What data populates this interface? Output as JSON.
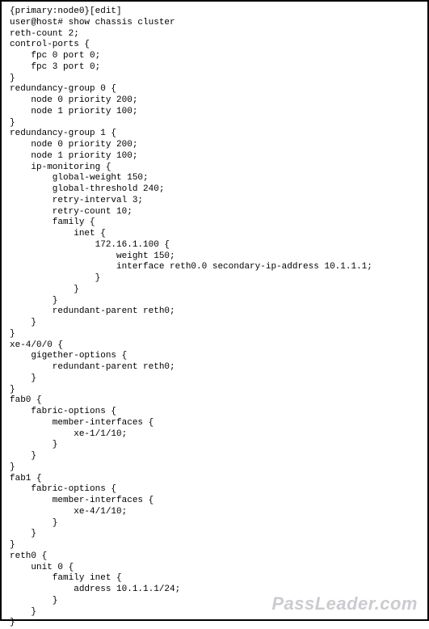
{
  "config_text": "{primary:node0}[edit]\nuser@host# show chassis cluster\nreth-count 2;\ncontrol-ports {\n    fpc 0 port 0;\n    fpc 3 port 0;\n}\nredundancy-group 0 {\n    node 0 priority 200;\n    node 1 priority 100;\n}\nredundancy-group 1 {\n    node 0 priority 200;\n    node 1 priority 100;\n    ip-monitoring {\n        global-weight 150;\n        global-threshold 240;\n        retry-interval 3;\n        retry-count 10;\n        family {\n            inet {\n                172.16.1.100 {\n                    weight 150;\n                    interface reth0.0 secondary-ip-address 10.1.1.1;\n                }\n            }\n        }\n        redundant-parent reth0;\n    }\n}\nxe-4/0/0 {\n    gigether-options {\n        redundant-parent reth0;\n    }\n}\nfab0 {\n    fabric-options {\n        member-interfaces {\n            xe-1/1/10;\n        }\n    }\n}\nfab1 {\n    fabric-options {\n        member-interfaces {\n            xe-4/1/10;\n        }\n    }\n}\nreth0 {\n    unit 0 {\n        family inet {\n            address 10.1.1.1/24;\n        }\n    }\n}",
  "watermark": "PassLeader.com"
}
